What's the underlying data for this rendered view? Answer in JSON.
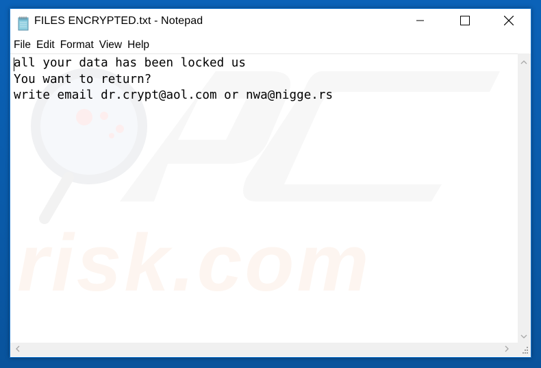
{
  "window": {
    "title": "FILES ENCRYPTED.txt - Notepad",
    "app_icon": "notepad-icon",
    "controls": {
      "minimize": "minimize-icon",
      "maximize": "maximize-icon",
      "close": "close-icon"
    }
  },
  "menubar": {
    "items": [
      {
        "label": "File"
      },
      {
        "label": "Edit"
      },
      {
        "label": "Format"
      },
      {
        "label": "View"
      },
      {
        "label": "Help"
      }
    ]
  },
  "editor": {
    "lines": [
      "all your data has been locked us",
      "You want to return?",
      "write email dr.crypt@aol.com or nwa@nigge.rs"
    ]
  },
  "watermark": {
    "text": "risk.com",
    "logo": "PC"
  },
  "scrollbars": {
    "up": "chevron-up-icon",
    "down": "chevron-down-icon",
    "left": "chevron-left-icon",
    "right": "chevron-right-icon"
  },
  "colors": {
    "desktop": "#0a5cad",
    "window_border": "#1a78d0",
    "scrollbar_bg": "#f0f0f0",
    "watermark_gray": "#f2f2f2",
    "watermark_orange": "#fdf5f0"
  }
}
